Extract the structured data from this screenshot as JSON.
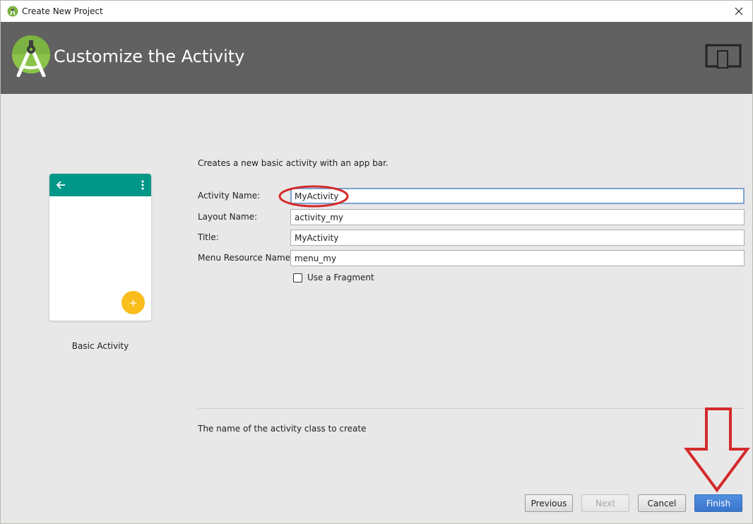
{
  "window": {
    "title": "Create New Project",
    "app_icon": "android-studio-icon",
    "close_icon": "close-icon"
  },
  "header": {
    "title": "Customize the Activity",
    "logo": "android-studio-logo",
    "device_icon": "tablet-phone-icon"
  },
  "preview": {
    "template_name": "Basic Activity",
    "appbar_color": "#009688",
    "fab_color": "#f9be1b",
    "fab_symbol": "+",
    "icons": [
      "back-arrow-icon",
      "overflow-menu-icon",
      "add-icon"
    ]
  },
  "form": {
    "description": "Creates a new basic activity with an app bar.",
    "fields": [
      {
        "label": "Activity Name:",
        "value": "MyActivity",
        "focused": true
      },
      {
        "label": "Layout Name:",
        "value": "activity_my"
      },
      {
        "label": "Title:",
        "value": "MyActivity"
      },
      {
        "label": "Menu Resource Name:",
        "value": "menu_my"
      }
    ],
    "use_fragment": {
      "label": "Use a Fragment",
      "checked": false
    },
    "hint": "The name of the activity class to create"
  },
  "buttons": {
    "previous": "Previous",
    "next": "Next",
    "cancel": "Cancel",
    "finish": "Finish"
  },
  "annotations": {
    "color": "#d42a2a",
    "items": [
      "circle-highlight-activity-name",
      "down-arrow-to-finish"
    ]
  }
}
